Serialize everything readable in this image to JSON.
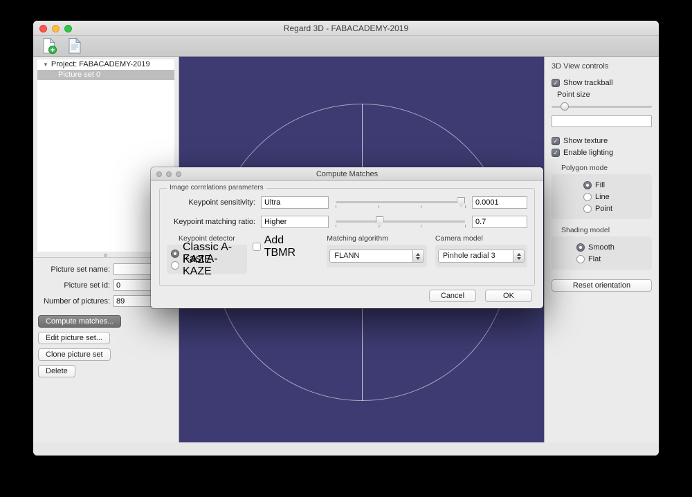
{
  "titlebar": {
    "title": "Regard 3D - FABACADEMY-2019"
  },
  "sidebar": {
    "project_label": "Project: FABACADEMY-2019",
    "picture_set_label": "Picture set 0",
    "fields": [
      {
        "label": "Picture set name:",
        "value": ""
      },
      {
        "label": "Picture set id:",
        "value": "0"
      },
      {
        "label": "Number of pictures:",
        "value": "89"
      }
    ],
    "buttons": {
      "compute": "Compute matches...",
      "edit": "Edit picture set...",
      "clone": "Clone picture set",
      "delete": "Delete"
    }
  },
  "view_controls": {
    "title": "3D View controls",
    "show_trackball": "Show trackball",
    "point_size_label": "Point size",
    "point_size_value": "",
    "show_texture": "Show texture",
    "enable_lighting": "Enable lighting",
    "polygon_mode": {
      "label": "Polygon mode",
      "options": [
        {
          "label": "Fill"
        },
        {
          "label": "Line"
        },
        {
          "label": "Point"
        }
      ],
      "selected": "Fill"
    },
    "shading_model": {
      "label": "Shading model",
      "options": [
        {
          "label": "Smooth"
        },
        {
          "label": "Flat"
        }
      ],
      "selected": "Smooth"
    },
    "reset_button": "Reset orientation"
  },
  "dialog": {
    "title": "Compute Matches",
    "group_label": "Image correlations parameters",
    "sensitivity": {
      "label": "Keypoint sensitivity:",
      "preset": "Ultra",
      "value": "0.0001",
      "slider_percent": 97
    },
    "matching_ratio": {
      "label": "Keypoint matching ratio:",
      "preset": "Higher",
      "value": "0.7",
      "slider_percent": 34
    },
    "keypoint_detector": {
      "label": "Keypoint detector",
      "options": [
        {
          "label": "Classic A-KAZE"
        },
        {
          "label": "Fast A-KAZE"
        }
      ],
      "selected": "Classic A-KAZE"
    },
    "add_tbmr_label": "Add TBMR",
    "matching_algorithm": {
      "label": "Matching algorithm",
      "value": "FLANN"
    },
    "camera_model": {
      "label": "Camera model",
      "value": "Pinhole radial 3"
    },
    "buttons": {
      "cancel": "Cancel",
      "ok": "OK"
    }
  }
}
